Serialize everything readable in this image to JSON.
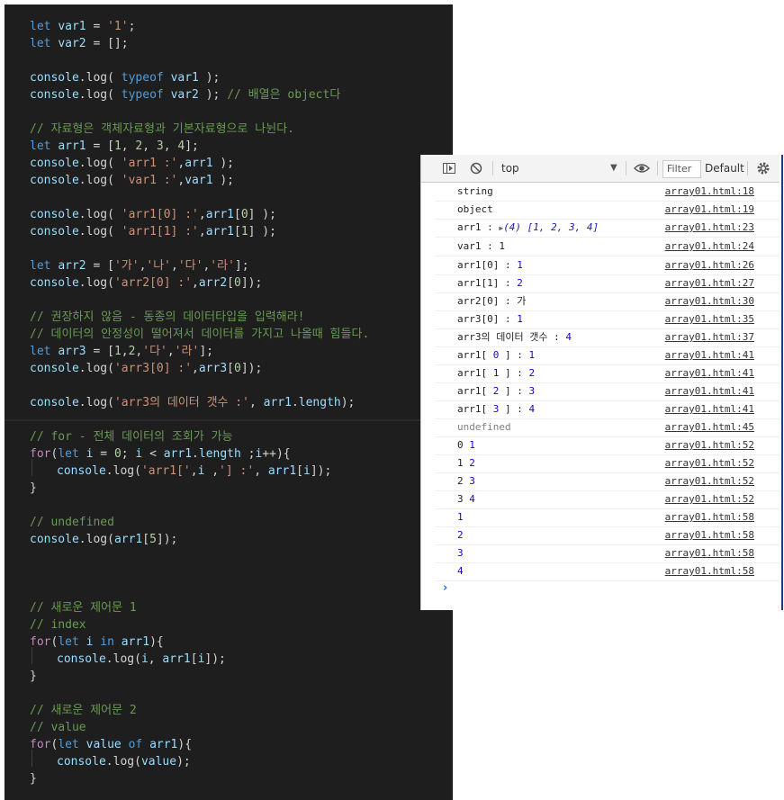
{
  "editor": {
    "l01": [
      "let ",
      "var1",
      " = ",
      "'1'",
      ";"
    ],
    "l02": [
      "let ",
      "var2",
      " = [];"
    ],
    "l03": [
      "console",
      ".",
      "log",
      "( ",
      "typeof ",
      "var1",
      " );"
    ],
    "l04": [
      "console",
      ".",
      "log",
      "( ",
      "typeof ",
      "var2",
      " ); ",
      "// 배열은 object다"
    ],
    "l05": [
      "// 자료형은 객체자료형과 기본자료형으로 나뉜다."
    ],
    "l06": [
      "let ",
      "arr1",
      " = [",
      "1",
      ", ",
      "2",
      ", ",
      "3",
      ", ",
      "4",
      "];"
    ],
    "l07": [
      "console",
      ".",
      "log",
      "( ",
      "'arr1 :'",
      ",",
      "arr1",
      " );"
    ],
    "l08": [
      "console",
      ".",
      "log",
      "( ",
      "'var1 :'",
      ",",
      "var1",
      " );"
    ],
    "l09": [
      "console",
      ".",
      "log",
      "( ",
      "'arr1[0] :'",
      ",",
      "arr1",
      "[",
      "0",
      "] );"
    ],
    "l10": [
      "console",
      ".",
      "log",
      "( ",
      "'arr1[1] :'",
      ",",
      "arr1",
      "[",
      "1",
      "] );"
    ],
    "l11": [
      "let ",
      "arr2",
      " = [",
      "'가'",
      ",",
      "'나'",
      ",",
      "'다'",
      ",",
      "'라'",
      "];"
    ],
    "l12": [
      "console",
      ".",
      "log",
      "(",
      "'arr2[0] :'",
      ",",
      "arr2",
      "[",
      "0",
      "]);"
    ],
    "l13": [
      "// 권장하지 않음 - 동종의 데이터타입을 입력해라!"
    ],
    "l14": [
      "// 데이터의 안정성이 떨어져서 데이터를 가지고 나올때 힘들다."
    ],
    "l15": [
      "let ",
      "arr3",
      " = [",
      "1",
      ",",
      "2",
      ",",
      "'다'",
      ",",
      "'라'",
      "];"
    ],
    "l16": [
      "console",
      ".",
      "log",
      "(",
      "'arr3[0] :'",
      ",",
      "arr3",
      "[",
      "0",
      "]);"
    ],
    "l17": [
      "console",
      ".",
      "log",
      "(",
      "'arr3의 데이터 갯수 :'",
      ", ",
      "arr1",
      ".",
      "length",
      ");"
    ],
    "l18": [
      "// for - 전체 데이터의 조회가 가능"
    ],
    "l19": [
      "for",
      "(",
      "let ",
      "i",
      " = ",
      "0",
      "; ",
      "i",
      " < ",
      "arr1",
      ".",
      "length",
      " ;",
      "i",
      "++){"
    ],
    "l20": [
      "console",
      ".",
      "log",
      "(",
      "'arr1['",
      ",",
      "i",
      " ,",
      "'] :'",
      ", ",
      "arr1",
      "[",
      "i",
      "]);"
    ],
    "l21": [
      "}"
    ],
    "l22": [
      "// undefined"
    ],
    "l23": [
      "console",
      ".",
      "log",
      "(",
      "arr1",
      "[",
      "5",
      "]);"
    ],
    "l24": [
      "// 새로운 제어문 1"
    ],
    "l25": [
      "// index"
    ],
    "l26": [
      "for",
      "(",
      "let ",
      "i",
      " in ",
      "arr1",
      "){"
    ],
    "l27": [
      "console",
      ".",
      "log",
      "(",
      "i",
      ", ",
      "arr1",
      "[",
      "i",
      "]);"
    ],
    "l28": [
      "}"
    ],
    "l29": [
      "// 새로운 제어문 2"
    ],
    "l30": [
      "// value"
    ],
    "l31": [
      "for",
      "(",
      "let ",
      "value",
      " of ",
      "arr1",
      "){"
    ],
    "l32": [
      "console",
      ".",
      "log",
      "(",
      "value",
      ");"
    ],
    "l33": [
      "}"
    ]
  },
  "devtools": {
    "context": "top",
    "filter_placeholder": "Filter",
    "levels": "Default",
    "rows": [
      {
        "msg": "string",
        "src": "array01.html:18"
      },
      {
        "msg": "object",
        "src": "array01.html:19"
      },
      {
        "msg_label": "arr1 : ",
        "msg_array": "(4) [1, 2, 3, 4]",
        "src": "array01.html:23"
      },
      {
        "msg": "var1 : 1",
        "src": "array01.html:24"
      },
      {
        "msg_label": "arr1[0] : ",
        "msg_num": "1",
        "src": "array01.html:26"
      },
      {
        "msg_label": "arr1[1] : ",
        "msg_num": "2",
        "src": "array01.html:27"
      },
      {
        "msg": "arr2[0] : 가",
        "src": "array01.html:30"
      },
      {
        "msg_label": "arr3[0] : ",
        "msg_num": "1",
        "src": "array01.html:35"
      },
      {
        "msg_label": "arr3의 데이터 갯수 : ",
        "msg_num": "4",
        "src": "array01.html:37"
      },
      {
        "msg_label": "arr1[ ",
        "msg_num": "0",
        "msg_tail": " ] : ",
        "msg_num2": "1",
        "src": "array01.html:41"
      },
      {
        "msg_label": "arr1[ ",
        "msg_num": "1",
        "msg_tail": " ] : ",
        "msg_num2": "2",
        "src": "array01.html:41"
      },
      {
        "msg_label": "arr1[ ",
        "msg_num": "2",
        "msg_tail": " ] : ",
        "msg_num2": "3",
        "src": "array01.html:41"
      },
      {
        "msg_label": "arr1[ ",
        "msg_num": "3",
        "msg_tail": " ] : ",
        "msg_num2": "4",
        "src": "array01.html:41"
      },
      {
        "msg_undef": "undefined",
        "src": "array01.html:45"
      },
      {
        "msg_label": "0 ",
        "msg_num": "1",
        "src": "array01.html:52"
      },
      {
        "msg_label": "1 ",
        "msg_num": "2",
        "src": "array01.html:52"
      },
      {
        "msg_label": "2 ",
        "msg_num": "3",
        "src": "array01.html:52"
      },
      {
        "msg_label": "3 ",
        "msg_num": "4",
        "src": "array01.html:52"
      },
      {
        "msg_num": "1",
        "src": "array01.html:58"
      },
      {
        "msg_num": "2",
        "src": "array01.html:58"
      },
      {
        "msg_num": "3",
        "src": "array01.html:58"
      },
      {
        "msg_num": "4",
        "src": "array01.html:58"
      }
    ],
    "prompt": "›"
  }
}
